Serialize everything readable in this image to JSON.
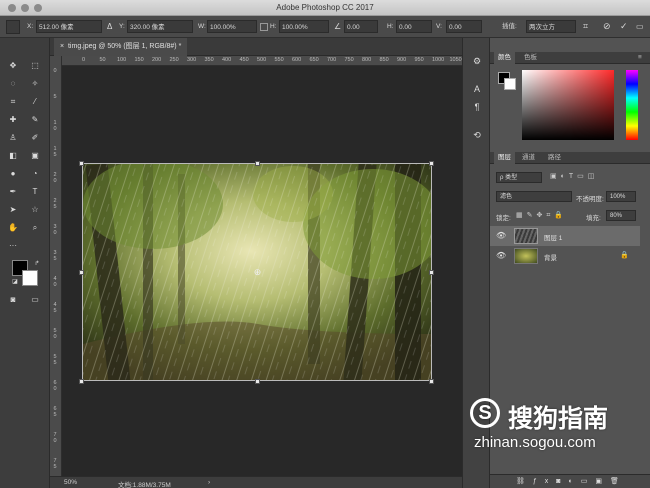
{
  "window": {
    "title": "Adobe Photoshop CC 2017"
  },
  "options_bar": {
    "x_label": "X:",
    "x_value": "512.00 像素",
    "delta_label": "Δ",
    "y_label": "Y:",
    "y_value": "320.00 像素",
    "w_label": "W:",
    "w_value": "100.00%",
    "h_label": "H:",
    "h_value": "100.00%",
    "angle_value": "0.00",
    "hskew_label": "H:",
    "hskew_value": "0.00",
    "vskew_label": "V:",
    "vskew_value": "0.00",
    "interp_label": "插值:",
    "interp_value": "两次立方"
  },
  "document": {
    "tab_title": "timg.jpeg @ 50% (图层 1, RGB/8#) *",
    "close": "×"
  },
  "ruler": {
    "top": [
      "0",
      "50",
      "100",
      "150",
      "200",
      "250",
      "300",
      "350",
      "400",
      "450",
      "500",
      "550",
      "600",
      "650",
      "700",
      "750",
      "800",
      "850",
      "900",
      "950",
      "1000",
      "1050"
    ],
    "left": [
      "0",
      "5",
      "10",
      "15",
      "20",
      "25",
      "30",
      "35",
      "40",
      "45",
      "50",
      "55",
      "60",
      "65",
      "70",
      "75"
    ]
  },
  "status": {
    "zoom": "50%",
    "doc_size": "文档:1.88M/3.75M",
    "arrow": "›"
  },
  "color_panel": {
    "tabs": [
      "颜色",
      "色板"
    ],
    "menu": "≡"
  },
  "layers_panel": {
    "tabs": [
      "图层",
      "通道",
      "路径"
    ],
    "filter": "ρ 类型",
    "blend_mode": "滤色",
    "opacity_label": "不透明度:",
    "opacity_value": "100%",
    "lock_label": "锁定:",
    "fill_label": "填充:",
    "fill_value": "80%",
    "layers": [
      {
        "name": "图层 1",
        "selected": true
      },
      {
        "name": "背景",
        "locked": true
      }
    ]
  },
  "watermark": {
    "logo": "S",
    "brand": "搜狗指南",
    "url": "zhinan.sogou.com"
  },
  "colors": {
    "accent": "#3d73c7",
    "panel_bg": "#535353",
    "canvas_bg": "#282828"
  }
}
